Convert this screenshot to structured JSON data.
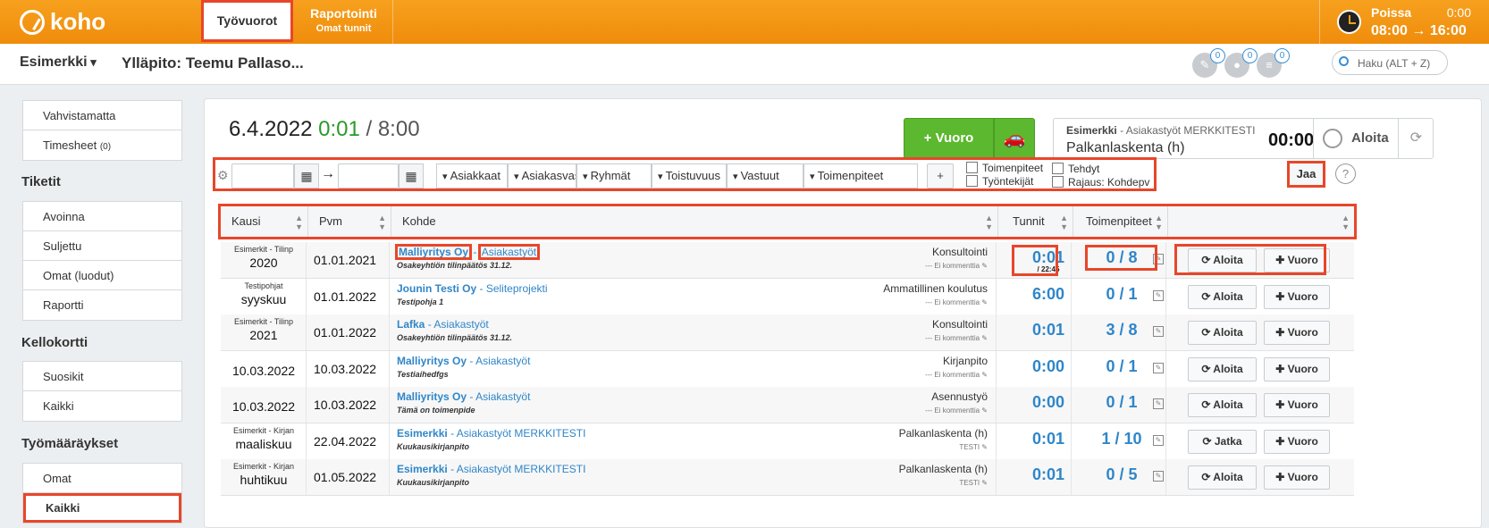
{
  "header": {
    "logo": "koho",
    "tabs": [
      {
        "label": "Työvuorot",
        "sub": ""
      },
      {
        "label": "Raportointi",
        "sub": "Omat tunnit"
      }
    ],
    "clock": {
      "status": "Poissa",
      "time": "0:00",
      "range": "08:00 → 16:00"
    }
  },
  "subheader": {
    "company": "Esimerkki",
    "admin": "Ylläpito: Teemu Pallaso...",
    "badges": [
      {
        "icon": "ticket-icon",
        "count": "0"
      },
      {
        "icon": "group-icon",
        "count": "0"
      },
      {
        "icon": "list-icon",
        "count": "0"
      }
    ],
    "search_placeholder": "Haku (ALT + Z)"
  },
  "sidebar": {
    "top": [
      {
        "label": "Vahvistamatta"
      },
      {
        "label": "Timesheet",
        "count": "(0)"
      }
    ],
    "sections": [
      {
        "title": "Tiketit",
        "items": [
          "Avoinna",
          "Suljettu",
          "Omat (luodut)",
          "Raportti"
        ]
      },
      {
        "title": "Kellokortti",
        "items": [
          "Suosikit",
          "Kaikki"
        ]
      },
      {
        "title": "Työmääräykset",
        "items": [
          "Omat",
          "Kaikki"
        ]
      }
    ]
  },
  "main": {
    "date": "6.4.2022",
    "worked": "0:01",
    "separator": "/",
    "planned": "8:00",
    "vuoro_button": "+ Vuoro",
    "timer": {
      "company": "Esimerkki",
      "project": "- Asiakastyöt MERKKITESTI",
      "task": "Palkanlaskenta (h)",
      "time": "00:00",
      "start": "Aloita"
    },
    "filters": {
      "selects": [
        "Asiakkaat",
        "Asiakasvast",
        "Ryhmät",
        "Toistuvuus",
        "Vastuut",
        "Toimenpiteet"
      ],
      "add": "+",
      "checkboxes": [
        "Toimenpiteet",
        "Työntekijät",
        "Tehdyt",
        "Rajaus: Kohdepv"
      ],
      "share": "Jaa",
      "help": "?"
    },
    "table": {
      "columns": [
        "Kausi",
        "Pvm",
        "Kohde",
        "Tunnit",
        "Toimenpiteet",
        ""
      ],
      "rows": [
        {
          "kausi_small": "Esimerkit - Tilinp",
          "kausi": "2020",
          "pvm": "01.01.2021",
          "client": "Malliyritys Oy",
          "project": "Asiakastyöt",
          "task": "Osakeyhtiön tilinpäätös 31.12.",
          "type": "Konsultointi",
          "comment": "--- Ei kommenttia",
          "hours": "0:01",
          "hours_sub": "/ 22:45",
          "tasks": "0 / 8",
          "action": "Aloita",
          "vuoro": "Vuoro"
        },
        {
          "kausi_small": "Testipohjat",
          "kausi": "syyskuu",
          "pvm": "01.01.2022",
          "client": "Jounin Testi Oy",
          "project": "Seliteprojekti",
          "task": "Testipohja 1",
          "type": "Ammatillinen koulutus",
          "comment": "--- Ei kommenttia",
          "hours": "6:00",
          "hours_sub": "",
          "tasks": "0 / 1",
          "action": "Aloita",
          "vuoro": "Vuoro"
        },
        {
          "kausi_small": "Esimerkit - Tilinp",
          "kausi": "2021",
          "pvm": "01.01.2022",
          "client": "Lafka",
          "project": "Asiakastyöt",
          "task": "Osakeyhtiön tilinpäätös 31.12.",
          "type": "Konsultointi",
          "comment": "--- Ei kommenttia",
          "hours": "0:01",
          "hours_sub": "",
          "tasks": "3 / 8",
          "action": "Aloita",
          "vuoro": "Vuoro"
        },
        {
          "kausi_small": "",
          "kausi": "10.03.2022",
          "pvm": "10.03.2022",
          "client": "Malliyritys Oy",
          "project": "Asiakastyöt",
          "task": "Testiaihedfgs",
          "type": "Kirjanpito",
          "comment": "--- Ei kommenttia",
          "hours": "0:00",
          "hours_sub": "",
          "tasks": "0 / 1",
          "action": "Aloita",
          "vuoro": "Vuoro"
        },
        {
          "kausi_small": "",
          "kausi": "10.03.2022",
          "pvm": "10.03.2022",
          "client": "Malliyritys Oy",
          "project": "Asiakastyöt",
          "task": "Tämä on toimenpide",
          "type": "Asennustyö",
          "comment": "--- Ei kommenttia",
          "hours": "0:00",
          "hours_sub": "",
          "tasks": "0 / 1",
          "action": "Aloita",
          "vuoro": "Vuoro"
        },
        {
          "kausi_small": "Esimerkit - Kirjan",
          "kausi": "maaliskuu",
          "pvm": "22.04.2022",
          "client": "Esimerkki",
          "project": "Asiakastyöt MERKKITESTI",
          "task": "Kuukausikirjanpito",
          "type": "Palkanlaskenta (h)",
          "comment": "TESTI",
          "hours": "0:01",
          "hours_sub": "",
          "tasks": "1 / 10",
          "action": "Jatka",
          "vuoro": "Vuoro"
        },
        {
          "kausi_small": "Esimerkit - Kirjan",
          "kausi": "huhtikuu",
          "pvm": "01.05.2022",
          "client": "Esimerkki",
          "project": "Asiakastyöt MERKKITESTI",
          "task": "Kuukausikirjanpito",
          "type": "Palkanlaskenta (h)",
          "comment": "TESTI",
          "hours": "0:01",
          "hours_sub": "",
          "tasks": "0 / 5",
          "action": "Aloita",
          "vuoro": "Vuoro"
        }
      ]
    }
  },
  "colors": {
    "accent": "#f29410",
    "highlight": "#e8462a",
    "link": "#2f86c9",
    "green": "#5cb82e"
  }
}
